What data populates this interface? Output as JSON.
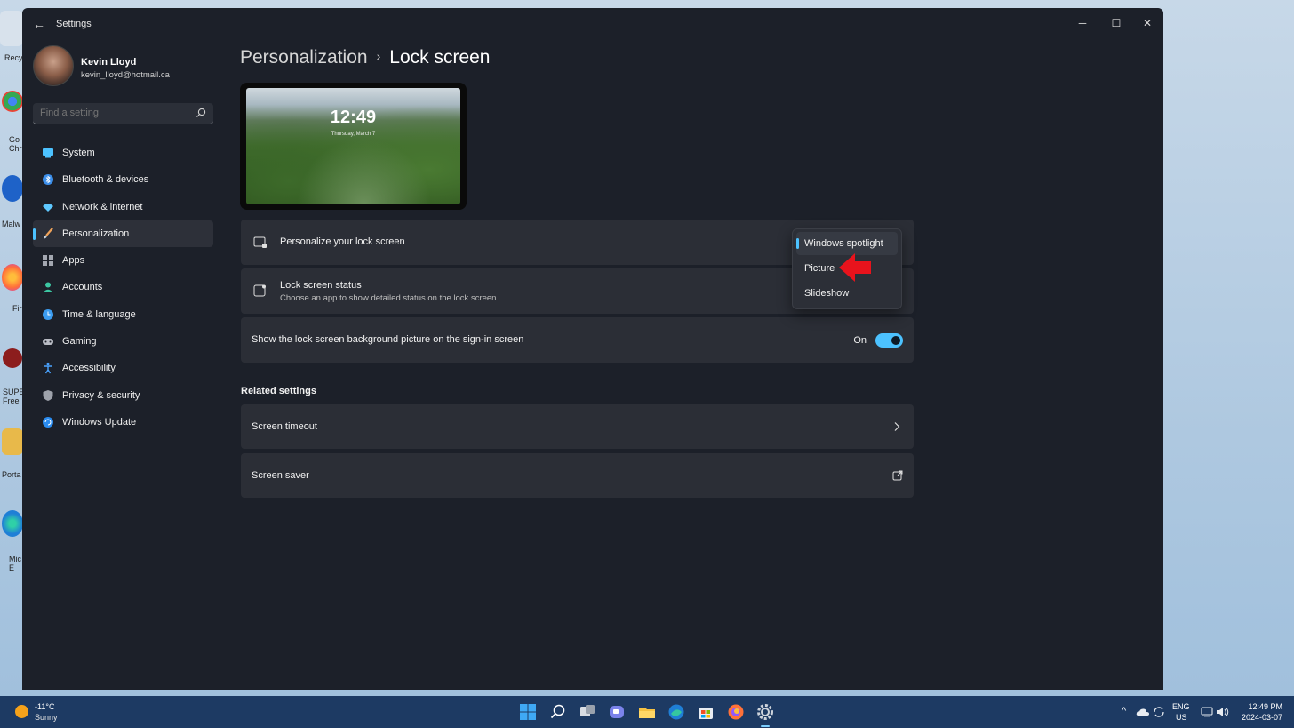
{
  "desktop": {
    "icon_labels": [
      "Recy",
      "Go Chr",
      "Malw",
      "Fir",
      "SUPE Free",
      "Porta",
      "Mic E"
    ]
  },
  "window": {
    "app_title": "Settings",
    "minimize": "─",
    "maximize": "☐",
    "close": "✕",
    "back": "←"
  },
  "profile": {
    "name": "Kevin Lloyd",
    "email": "kevin_lloyd@hotmail.ca"
  },
  "search": {
    "placeholder": "Find a setting"
  },
  "sidebar": {
    "items": [
      {
        "label": "System",
        "icon": "monitor-icon",
        "color": "#4cc2ff"
      },
      {
        "label": "Bluetooth & devices",
        "icon": "bluetooth-icon",
        "color": "#3b8eea"
      },
      {
        "label": "Network & internet",
        "icon": "wifi-icon",
        "color": "#5ec8ff"
      },
      {
        "label": "Personalization",
        "icon": "brush-icon",
        "color": "#f0a35a",
        "active": true
      },
      {
        "label": "Apps",
        "icon": "apps-icon",
        "color": "#a3a7b0"
      },
      {
        "label": "Accounts",
        "icon": "person-icon",
        "color": "#3cc7a3"
      },
      {
        "label": "Time & language",
        "icon": "globe-clock-icon",
        "color": "#3b9cf0"
      },
      {
        "label": "Gaming",
        "icon": "gamepad-icon",
        "color": "#b9bcc4"
      },
      {
        "label": "Accessibility",
        "icon": "accessibility-icon",
        "color": "#4aa3ff"
      },
      {
        "label": "Privacy & security",
        "icon": "shield-icon",
        "color": "#9ea2ab"
      },
      {
        "label": "Windows Update",
        "icon": "update-icon",
        "color": "#2a8cf0"
      }
    ]
  },
  "breadcrumb": {
    "parent": "Personalization",
    "separator": "›",
    "current": "Lock screen"
  },
  "preview": {
    "time": "12:49",
    "date": "Thursday, March 7"
  },
  "settings": {
    "personalize": {
      "title": "Personalize your lock screen"
    },
    "status": {
      "title": "Lock screen status",
      "subtitle": "Choose an app to show detailed status on the lock screen"
    },
    "signin": {
      "title": "Show the lock screen background picture on the sign-in screen",
      "state": "On"
    }
  },
  "dropdown": {
    "options": [
      "Windows spotlight",
      "Picture",
      "Slideshow"
    ],
    "selected": "Windows spotlight"
  },
  "related": {
    "title": "Related settings",
    "items": [
      {
        "label": "Screen timeout",
        "icon": "chevron-right-icon"
      },
      {
        "label": "Screen saver",
        "icon": "open-external-icon"
      }
    ]
  },
  "taskbar": {
    "weather": {
      "temp": "-11°C",
      "condition": "Sunny"
    },
    "apps": [
      "start-icon",
      "search-icon",
      "task-view-icon",
      "teams-chat-icon",
      "file-explorer-icon",
      "edge-icon",
      "store-icon",
      "firefox-icon",
      "settings-icon"
    ],
    "lang_top": "ENG",
    "lang_bottom": "US",
    "time": "12:49 PM",
    "date": "2024-03-07",
    "tray_chevron": "^"
  },
  "colors": {
    "accent": "#4cc2ff",
    "window_bg": "#1c2029",
    "card_bg": "#2b2e36",
    "taskbar_bg": "#1d3a63"
  }
}
